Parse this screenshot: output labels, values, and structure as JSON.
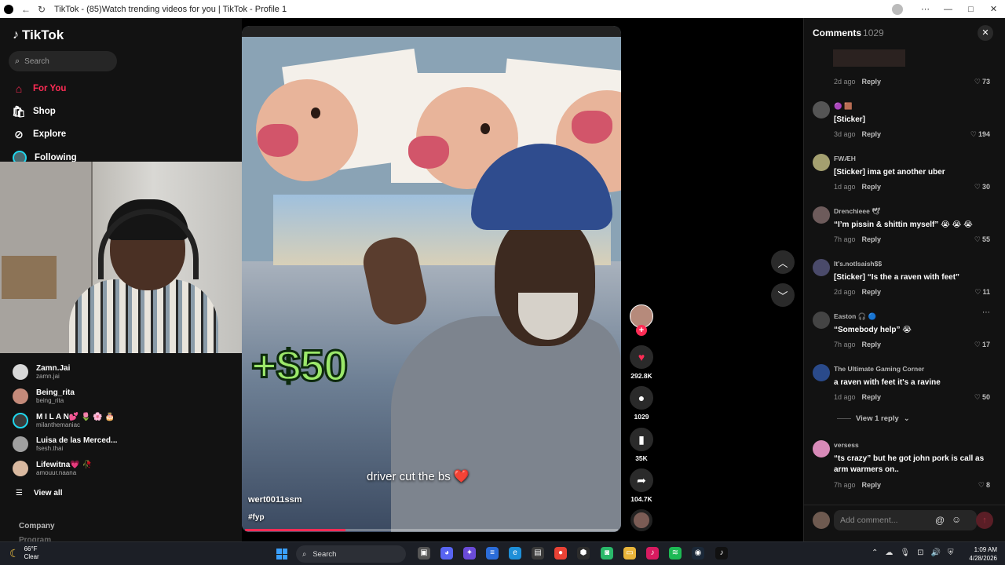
{
  "browser": {
    "tab_title": "TikTok - (85)Watch trending videos for you | TikTok - Profile 1"
  },
  "sidebar": {
    "logo": "TikTok",
    "search_placeholder": "Search",
    "nav": [
      {
        "label": "For You",
        "icon": "home-icon",
        "active": true
      },
      {
        "label": "Shop",
        "icon": "shop-icon"
      },
      {
        "label": "Explore",
        "icon": "compass-icon"
      },
      {
        "label": "Following",
        "icon": "following-avatar"
      }
    ],
    "accounts": [
      {
        "name": "Zamn.Jai",
        "username": "zamn.jai",
        "color": "#d8d8d8"
      },
      {
        "name": "Being_rita",
        "username": "being_rita",
        "color": "#c48a7a"
      },
      {
        "name": "M I L A N💕 🌷 🌸 🎂",
        "username": "milanthemaniac",
        "color": "#20d5ec"
      },
      {
        "name": "Luisa de las Merced...",
        "username": "fsesh.thai",
        "color": "#a0a0a0"
      },
      {
        "name": "Lifewitna💗 🥀",
        "username": "amouur.naana",
        "color": "#d9b9a0"
      }
    ],
    "view_all": "View all",
    "company": "Company",
    "program": "Program"
  },
  "video": {
    "overlay_amount": "+$50",
    "caption": "driver cut the bs",
    "caption_emoji": "❤️",
    "author": "wert0011ssm",
    "hashtag": "#fyp",
    "progress": 0.27
  },
  "actions": {
    "likes": "292.8K",
    "comments": "1029",
    "saves": "35K",
    "shares": "104.7K"
  },
  "comments": {
    "title": "Comments",
    "count": "1029",
    "items": [
      {
        "user": "",
        "text": "",
        "time": "2d ago",
        "likes": "73"
      },
      {
        "user": "🟣 🟫",
        "text": "[Sticker]",
        "time": "3d ago",
        "likes": "194",
        "color": "#555"
      },
      {
        "user": "FWÆH",
        "text": "[Sticker] ima get another uber",
        "time": "1d ago",
        "likes": "30",
        "color": "#a4a070"
      },
      {
        "user": "Drenchieee 🕊",
        "text": "“I’m pissin & shittin myself” 😭 😭 😭",
        "time": "7h ago",
        "likes": "55",
        "color": "#6d5b5b"
      },
      {
        "user": "It's.notIsaish$$",
        "text": "[Sticker] “Is the a raven with feet”",
        "time": "2d ago",
        "likes": "11",
        "color": "#4a4a6a"
      },
      {
        "user": "Easton 🎧 🔵",
        "text": "“Somebody help” 😭",
        "time": "7h ago",
        "likes": "17",
        "color": "#444"
      },
      {
        "user": "The Ultimate Gaming Corner",
        "text": "a raven with feet it's a ravine",
        "time": "1d ago",
        "likes": "50",
        "color": "#2a4a8a"
      },
      {
        "user": "versess",
        "text": "“ts crazy” but he got john pork is call as arm warmers on..",
        "time": "7h ago",
        "likes": "8",
        "color": "#d88ab8"
      }
    ],
    "reply_label": "Reply",
    "view_replies": "View 1 reply",
    "add_placeholder": "Add comment..."
  },
  "taskbar": {
    "temp": "66°F",
    "condition": "Clear",
    "search": "Search",
    "time": "1:09 AM",
    "date": "4/28/2026"
  }
}
